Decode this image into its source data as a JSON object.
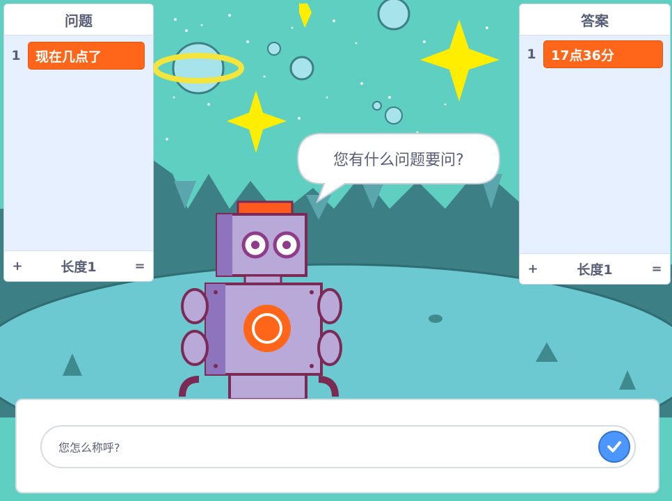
{
  "left_list": {
    "title": "问题",
    "items": [
      {
        "index": "1",
        "value": "现在几点了"
      }
    ],
    "footer": {
      "add": "+",
      "length": "长度1",
      "resize": "="
    }
  },
  "right_list": {
    "title": "答案",
    "items": [
      {
        "index": "1",
        "value": "17点36分"
      }
    ],
    "footer": {
      "add": "+",
      "length": "长度1",
      "resize": "="
    }
  },
  "speech_bubble": {
    "text": "您有什么问题要问?"
  },
  "ask_prompt": {
    "question": "您怎么称呼?",
    "submit_icon": "checkmark-icon"
  },
  "colors": {
    "accent": "#4c97ff",
    "list_item": "#ff661a",
    "sky": "#5fcfc0",
    "ground": "#3c7f84"
  }
}
